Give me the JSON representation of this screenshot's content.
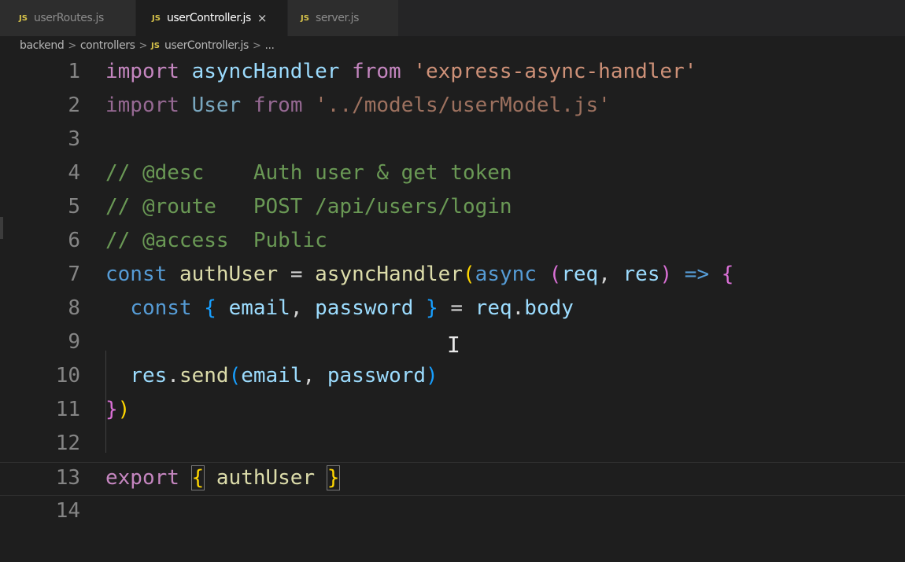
{
  "tabs": [
    {
      "label": "userRoutes.js",
      "icon": "JS",
      "active": false
    },
    {
      "label": "userController.js",
      "icon": "JS",
      "active": true,
      "close": "×"
    },
    {
      "label": "server.js",
      "icon": "JS",
      "active": false
    }
  ],
  "breadcrumb": {
    "parts": [
      "backend",
      "controllers",
      "userController.js",
      "..."
    ],
    "separator": ">",
    "file_icon": "JS"
  },
  "lines": [
    {
      "number": "1",
      "tokens": [
        "import",
        " ",
        "asyncHandler",
        " ",
        "from",
        " ",
        "'express-async-handler'"
      ]
    },
    {
      "number": "2",
      "tokens": [
        "import",
        " ",
        "User",
        " ",
        "from",
        " ",
        "'../models/userModel.js'"
      ]
    },
    {
      "number": "3",
      "tokens": []
    },
    {
      "number": "4",
      "tokens": [
        "// @desc    Auth user & get token"
      ]
    },
    {
      "number": "5",
      "tokens": [
        "// @route   POST /api/users/login"
      ]
    },
    {
      "number": "6",
      "tokens": [
        "// @access  Public"
      ]
    },
    {
      "number": "7",
      "tokens": [
        "const",
        " ",
        "authUser",
        " = ",
        "asyncHandler",
        "(",
        "async",
        " ",
        "(",
        "req",
        ", ",
        "res",
        ")",
        " ",
        "=>",
        " ",
        "{"
      ]
    },
    {
      "number": "8",
      "tokens": [
        "  ",
        "const",
        " ",
        "{",
        " ",
        "email",
        ", ",
        "password",
        " ",
        "}",
        " = ",
        "req",
        ".",
        "body"
      ]
    },
    {
      "number": "9",
      "tokens": []
    },
    {
      "number": "10",
      "tokens": [
        "  ",
        "res",
        ".",
        "send",
        "(",
        "email",
        ", ",
        "password",
        ")"
      ]
    },
    {
      "number": "11",
      "tokens": [
        "}",
        ")"
      ]
    },
    {
      "number": "12",
      "tokens": []
    },
    {
      "number": "13",
      "tokens": [
        "export",
        " ",
        "{",
        " ",
        "authUser",
        " ",
        "}"
      ]
    },
    {
      "number": "14",
      "tokens": []
    }
  ],
  "text_cursor": "I",
  "colors": {
    "background": "#1e1e1e",
    "keyword": "#c586c0",
    "function": "#dcdcaa",
    "string": "#ce9178",
    "comment": "#6a9955",
    "variable": "#9cdcfe",
    "storage": "#569cd6",
    "bracket_gold": "#ffd700",
    "bracket_orchid": "#da70d6",
    "bracket_blue": "#179fff"
  }
}
